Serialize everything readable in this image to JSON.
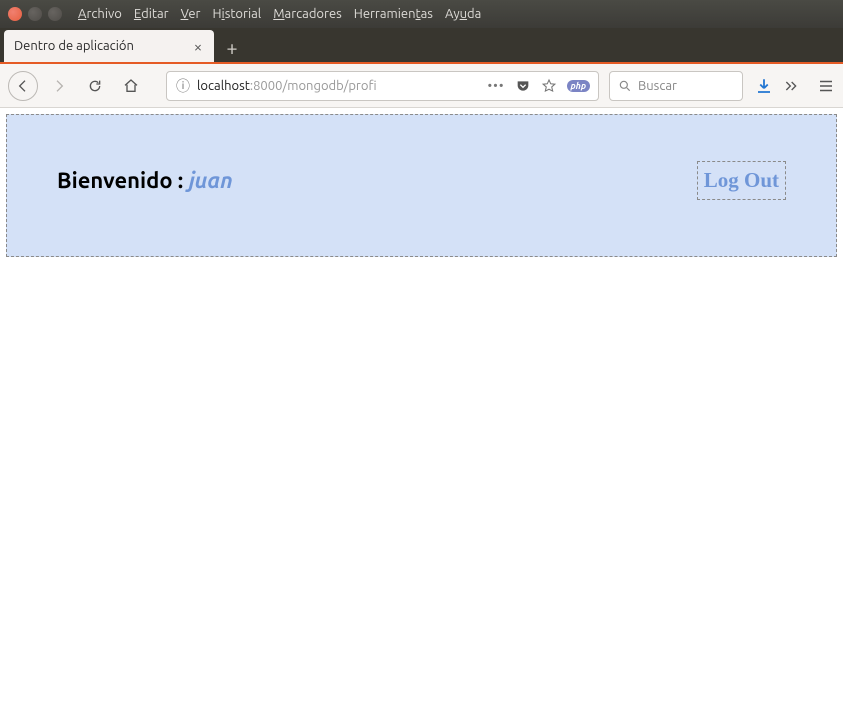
{
  "window": {
    "menus": [
      {
        "label": "Archivo",
        "accel": "A"
      },
      {
        "label": "Editar",
        "accel": "E"
      },
      {
        "label": "Ver",
        "accel": "V"
      },
      {
        "label": "Historial",
        "accel": "i"
      },
      {
        "label": "Marcadores",
        "accel": "M"
      },
      {
        "label": "Herramientas",
        "accel": "t"
      },
      {
        "label": "Ayuda",
        "accel": "u"
      }
    ]
  },
  "browser": {
    "tab_title": "Dentro de aplicación",
    "url_prefix": "localhost",
    "url_port": ":8000",
    "url_path": "/mongodb/profi",
    "php_badge": "php",
    "search_placeholder": "Buscar"
  },
  "page": {
    "welcome_label": "Bienvenido : ",
    "username": "juan",
    "logout_label": "Log Out"
  }
}
